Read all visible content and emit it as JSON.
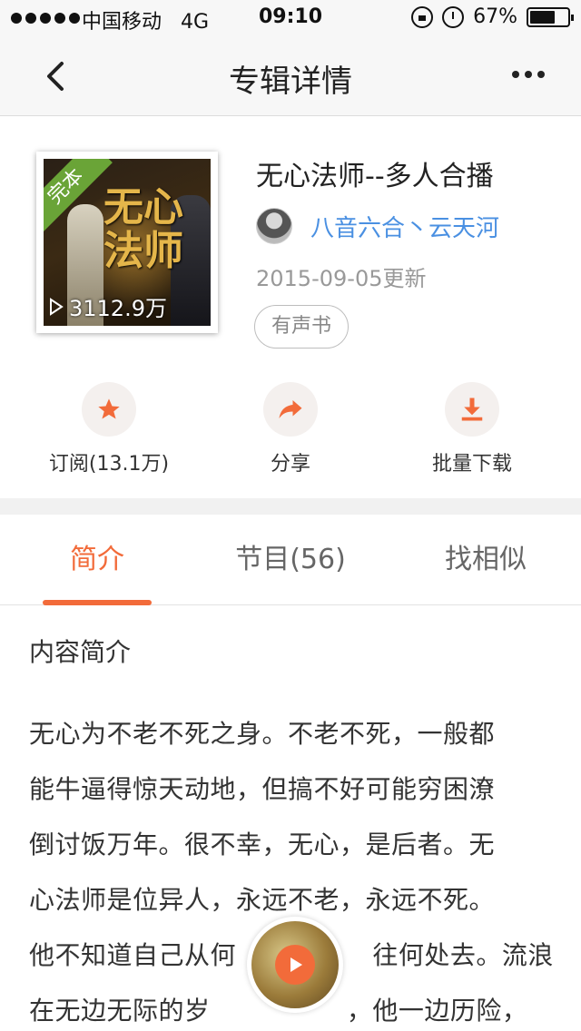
{
  "status_bar": {
    "carrier": "中国移动",
    "network": "4G",
    "time": "09:10",
    "battery": "67%",
    "battery_level": 0.67
  },
  "nav": {
    "title": "专辑详情",
    "back_icon": "chevron-left-icon",
    "more_icon": "more-dots-icon"
  },
  "album": {
    "title": "无心法师--多人合播",
    "ribbon": "完本",
    "cover_text": "无心法师",
    "play_count": "3112.9万",
    "author": "八音六合丶云天河",
    "updated": "2015-09-05更新",
    "tag": "有声书"
  },
  "actions": [
    {
      "icon": "star-icon",
      "label": "订阅(13.1万)"
    },
    {
      "icon": "share-icon",
      "label": "分享"
    },
    {
      "icon": "download-icon",
      "label": "批量下载"
    }
  ],
  "tabs": [
    {
      "label": "简介",
      "active": true
    },
    {
      "label": "节目(56)",
      "active": false
    },
    {
      "label": "找相似",
      "active": false
    }
  ],
  "intro": {
    "heading": "内容简介",
    "lines": [
      "无心为不老不死之身。不老不死，一般都",
      "能牛逼得惊天动地，但搞不好可能穷困潦",
      "倒讨饭万年。很不幸，无心，是后者。无",
      "心法师是位异人，永远不老，永远不死。",
      "他不知道自己从何                往何处去。流浪",
      "在无边无际的岁                ，他一边历险，"
    ]
  },
  "colors": {
    "accent": "#f26b3a",
    "link": "#4a90e2",
    "ribbon": "#6aa437"
  }
}
